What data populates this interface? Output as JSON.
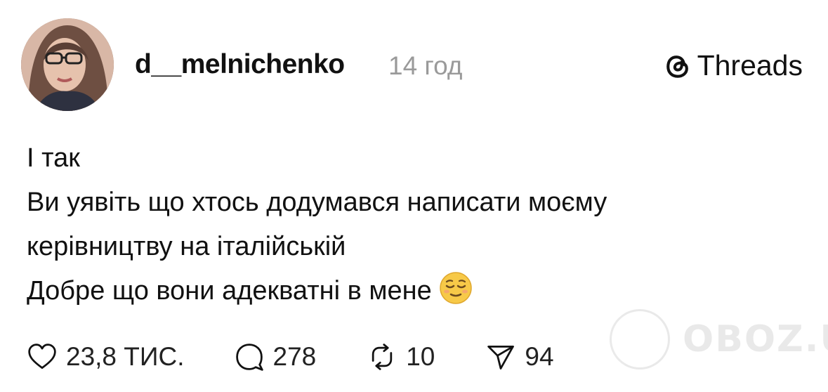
{
  "post": {
    "username": "d__melnichenko",
    "time": "14 год",
    "brand": "Threads",
    "lines": [
      "І так",
      "Ви уявіть що хтось додумався написати моєму",
      "керівництву на італійській",
      "Добре що вони адекватні в мене"
    ],
    "emoji": "relieved-face-emoji"
  },
  "actions": {
    "likes": "23,8 ТИС.",
    "replies": "278",
    "reposts": "10",
    "shares": "94"
  },
  "watermark": {
    "text": "OBOZ.UA"
  },
  "icons": {
    "like": "heart-icon",
    "reply": "comment-bubble-icon",
    "repost": "repost-icon",
    "share": "send-icon",
    "brand": "threads-logo-icon"
  },
  "colors": {
    "text": "#111111",
    "muted": "#9a9a9a",
    "background": "#ffffff"
  }
}
